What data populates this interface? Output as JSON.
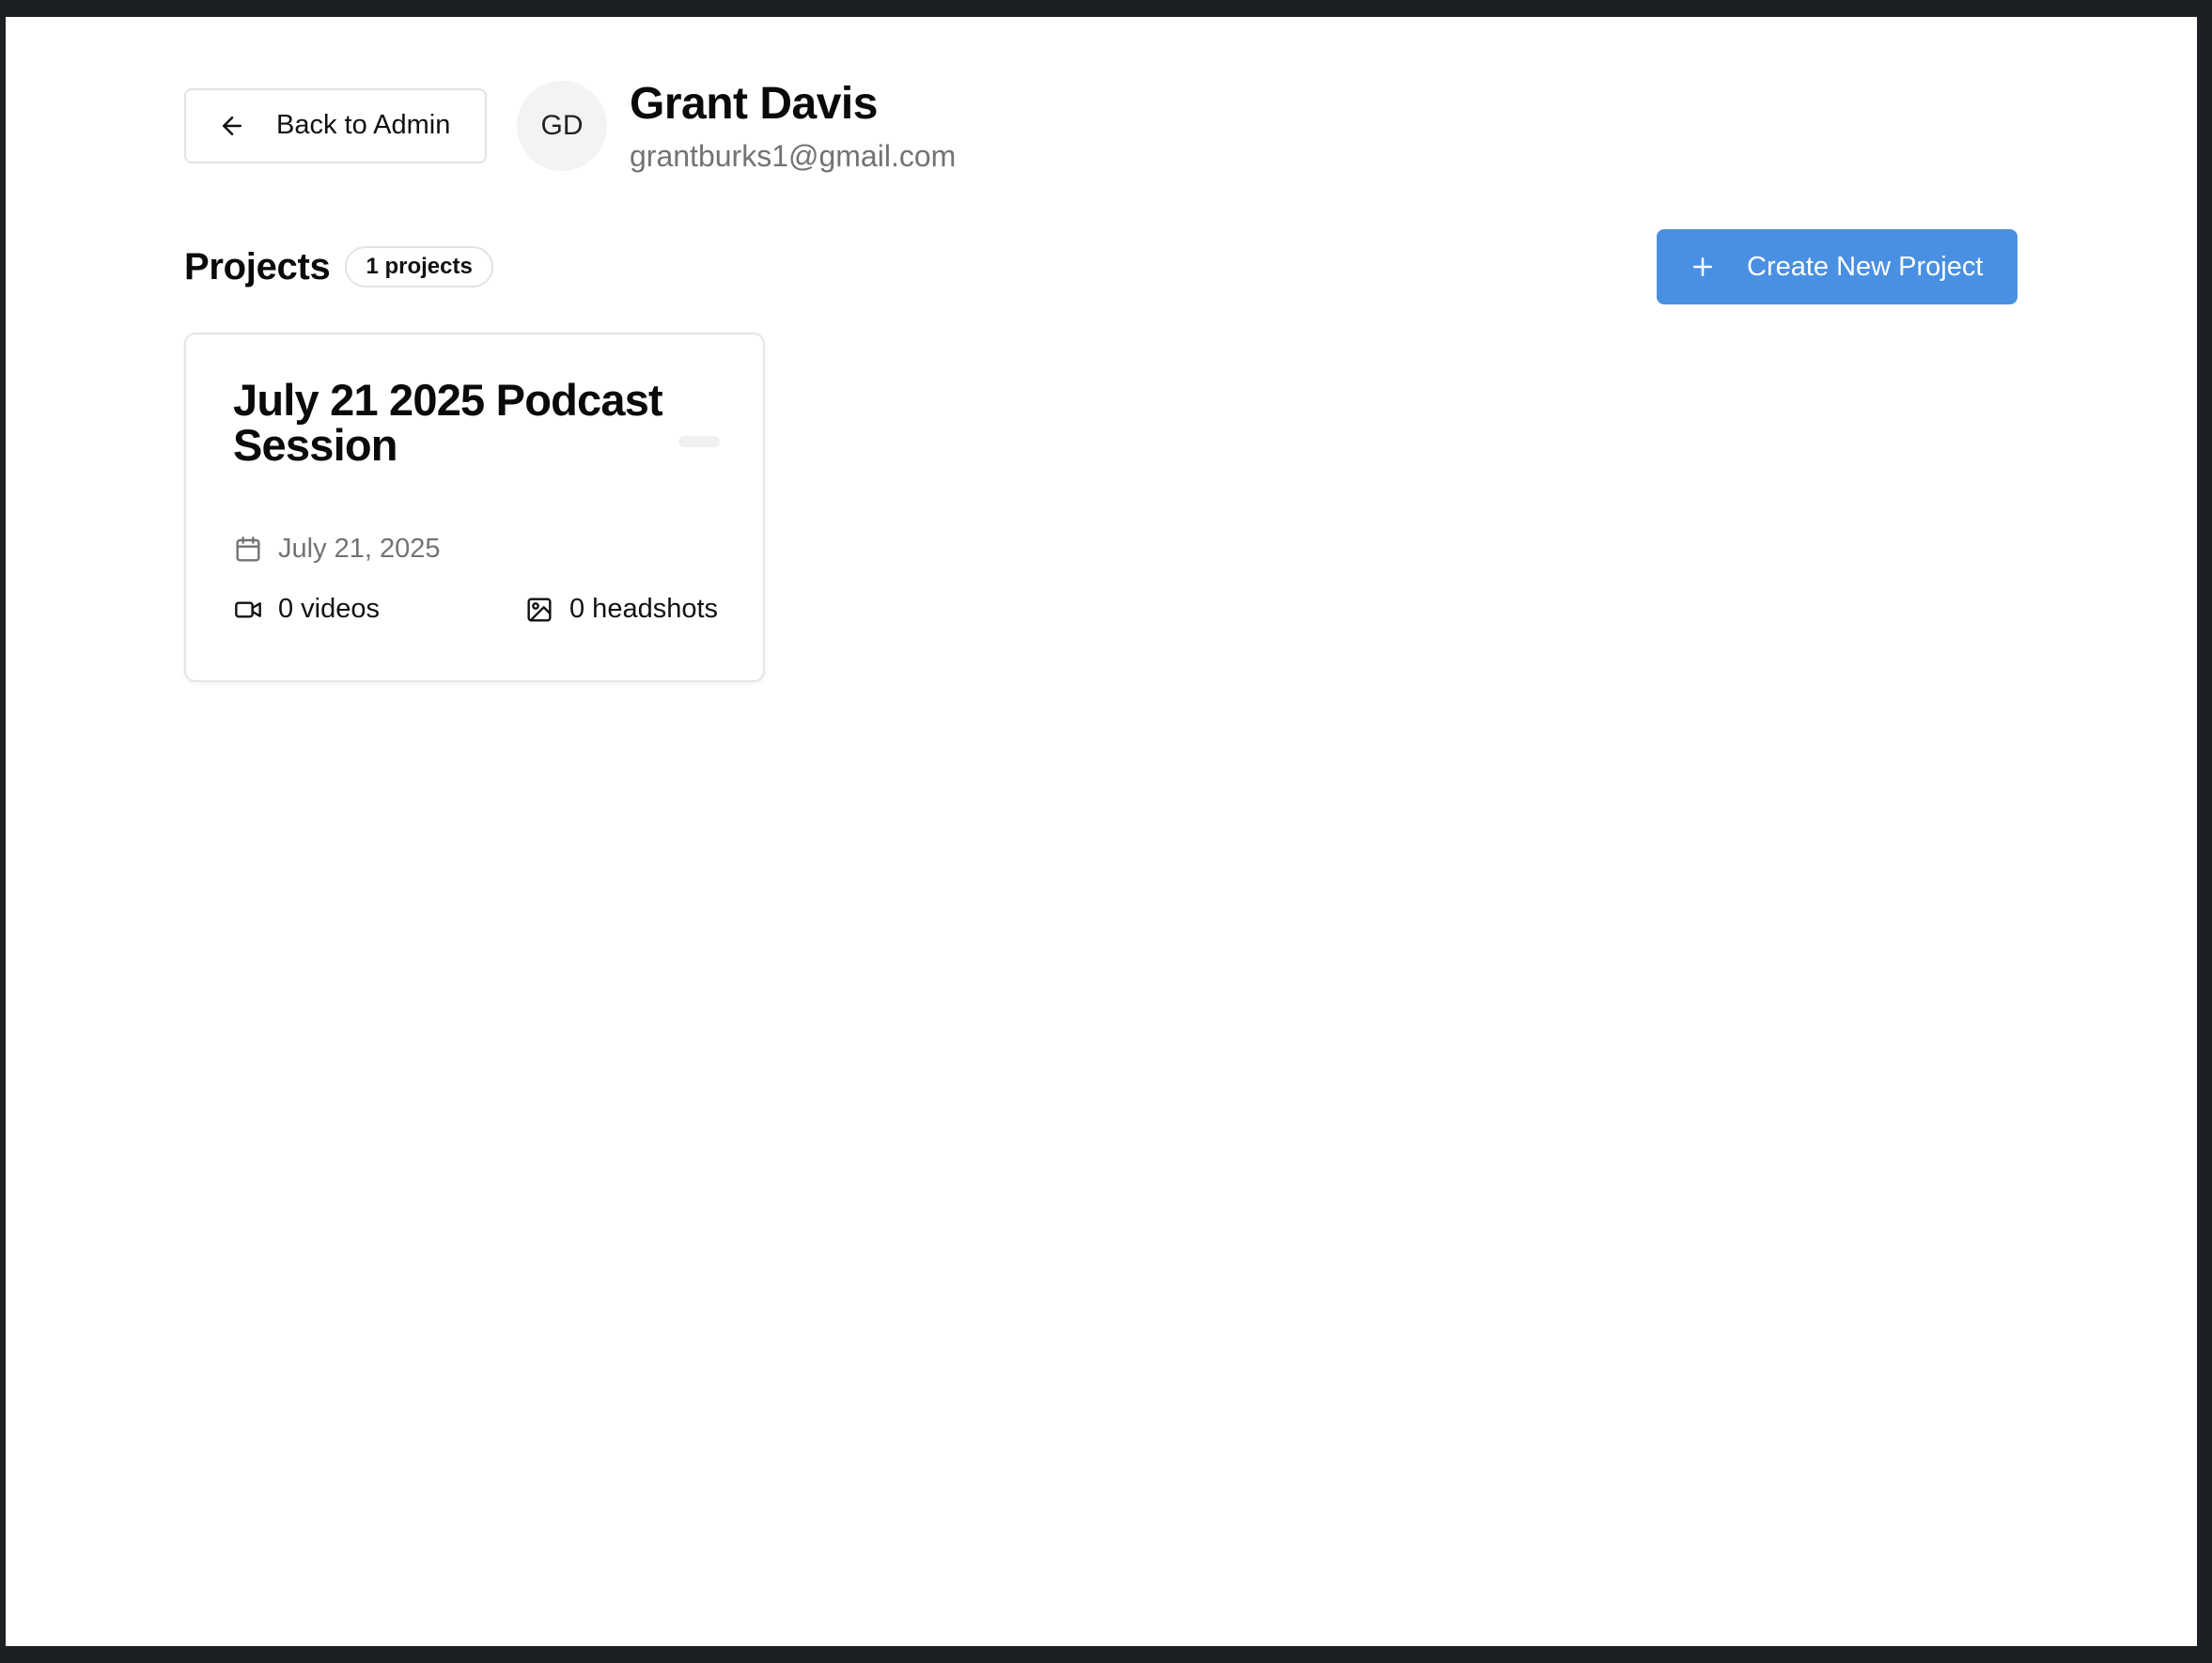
{
  "header": {
    "back_label": "Back to Admin",
    "avatar_initials": "GD",
    "user_name": "Grant Davis",
    "user_email": "grantburks1@gmail.com"
  },
  "projects": {
    "title": "Projects",
    "count_badge": "1 projects",
    "create_label": "Create New Project",
    "accent_color": "#4a90e2",
    "items": [
      {
        "title": "July 21 2025 Podcast Session",
        "date": "July 21, 2025",
        "videos": "0 videos",
        "headshots": "0 headshots",
        "icons": [
          "calendar-icon",
          "video-camera-icon",
          "image-icon"
        ]
      }
    ]
  }
}
